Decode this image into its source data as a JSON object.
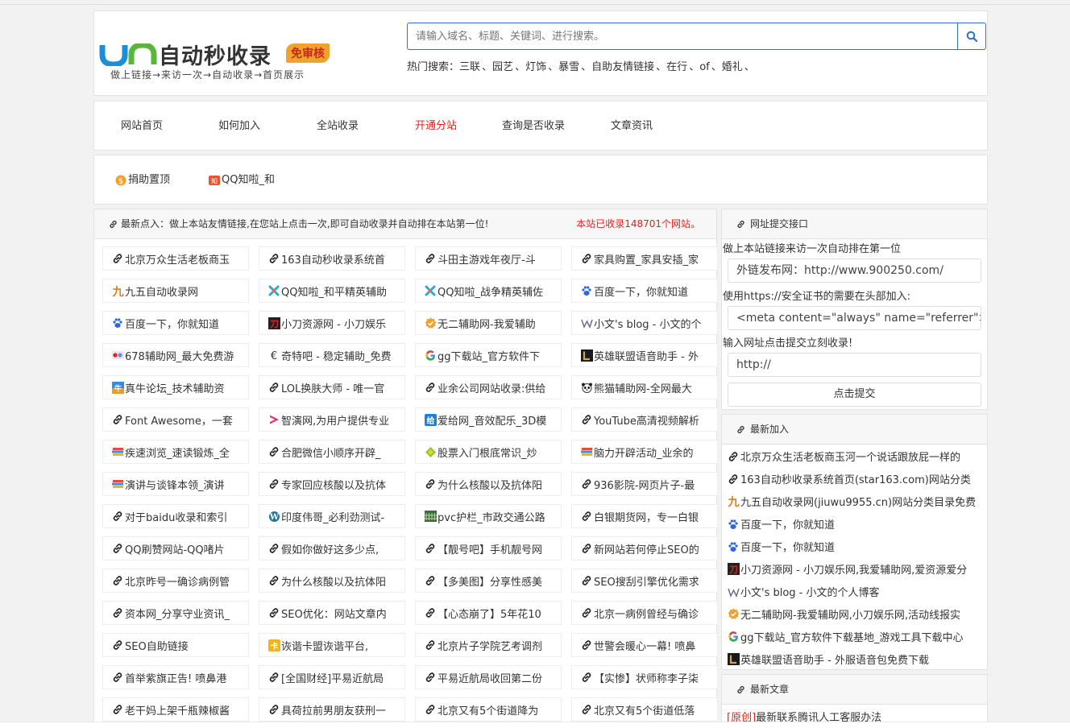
{
  "logo": {
    "text": "自动秒收录",
    "badge": "免审核",
    "subtitle": "做上链接→来访一次→自动收录→首页展示",
    "colors": {
      "blue": "#1a8fd8",
      "green": "#58b63b",
      "badge": "#f0a22c"
    }
  },
  "search": {
    "placeholder": "请输入域名、标题、关键词、进行搜索。",
    "icon": "search-icon",
    "hot_label": "热门搜索：",
    "hot_keywords": [
      "三联",
      "园艺",
      "灯饰",
      "暴雪",
      "自助友情链接",
      "在行",
      "of",
      "婚礼"
    ]
  },
  "nav": {
    "items": [
      "网站首页",
      "如何加入",
      "全站收录",
      "开通分站",
      "查询是否收录",
      "文章资讯"
    ],
    "active_color": "#e4211e"
  },
  "subnav": {
    "items": [
      {
        "label": "捐助置顶",
        "icon": "dollar-coin-icon"
      },
      {
        "label": "QQ知啦_和",
        "icon": "qq-zhila-icon"
      }
    ]
  },
  "main": {
    "note": "最新点入：做上本站友情链接,在您站上点击一次,即可自动收录并自动排在本站第一位!",
    "count": "本站已收录148701个网站。",
    "sites": [
      {
        "t": "北京万众生活老板商玉",
        "i": "link-icon"
      },
      {
        "t": "163自动秒收录系统首",
        "i": "link-icon"
      },
      {
        "t": "斗田主游戏年夜厅-斗",
        "i": "link-icon"
      },
      {
        "t": "家具购置_家具安插_家",
        "i": "link-icon"
      },
      {
        "t": "九五自动收录网",
        "i": "jiuwu-icon"
      },
      {
        "t": "QQ知啦_和平精英辅助",
        "i": "qq-zhila-icon"
      },
      {
        "t": "QQ知啦_战争精英辅佐",
        "i": "qq-zhila-icon"
      },
      {
        "t": "百度一下，你就知道",
        "i": "baidu-paw-icon"
      },
      {
        "t": "百度一下，你就知道",
        "i": "baidu-paw-icon"
      },
      {
        "t": "小刀资源网 - 小刀娱乐",
        "i": "xiaodao-icon"
      },
      {
        "t": "无二辅助网-我爱辅助",
        "i": "badge-check-icon"
      },
      {
        "t": "小文's blog - 小文的个",
        "i": "w-logo-icon"
      },
      {
        "t": "678辅助网_最大免费游",
        "i": "678-icon"
      },
      {
        "t": "奇特吧 - 稳定辅助_免费",
        "i": "euro-icon"
      },
      {
        "t": "gg下载站_官方软件下",
        "i": "google-g-icon"
      },
      {
        "t": "英雄联盟语音助手 - 外",
        "i": "lol-icon"
      },
      {
        "t": "真牛论坛_技术辅助资",
        "i": "zhenniu-icon"
      },
      {
        "t": "LOL换肤大师 - 唯一官",
        "i": "link-icon"
      },
      {
        "t": "业余公司网站收录:供给",
        "i": "link-icon"
      },
      {
        "t": "熊猫辅助网-全网最大",
        "i": "panda-icon"
      },
      {
        "t": "Font Awesome，一套",
        "i": "link-icon"
      },
      {
        "t": "智演网,为用户提供专业",
        "i": "play-icon"
      },
      {
        "t": "爱给网_音效配乐_3D模",
        "i": "aigei-icon"
      },
      {
        "t": "YouTube高清视频解析",
        "i": "link-icon"
      },
      {
        "t": "疾速浏览_速读锻炼_全",
        "i": "books-icon"
      },
      {
        "t": "合肥微信小顺序开辟_",
        "i": "link-icon"
      },
      {
        "t": "股票入门根底常识_炒",
        "i": "diamond-icon"
      },
      {
        "t": "脑力开辟活动_业余的",
        "i": "books-icon"
      },
      {
        "t": "演讲与谈锋本领_演讲",
        "i": "books-icon"
      },
      {
        "t": "专家回应核酸以及抗体",
        "i": "link-icon"
      },
      {
        "t": "为什么核酸以及抗体阳",
        "i": "link-icon"
      },
      {
        "t": "936影院-网页片子-最",
        "i": "link-icon"
      },
      {
        "t": "对于baidu收录和索引",
        "i": "link-icon"
      },
      {
        "t": "印度伟哥_必利劲测试-",
        "i": "wordpress-icon"
      },
      {
        "t": "pvc护栏_市政交通公路",
        "i": "fence-icon"
      },
      {
        "t": "白银期货网，专一白银",
        "i": "link-icon"
      },
      {
        "t": "QQ刷赞网站-QQ啫片",
        "i": "link-icon"
      },
      {
        "t": "假如你做好这多少点,",
        "i": "link-icon"
      },
      {
        "t": "【靓号吧】手机靓号网",
        "i": "link-icon"
      },
      {
        "t": "新网站若何停止SEO的",
        "i": "link-icon"
      },
      {
        "t": "北京昨号一确诊病例管",
        "i": "link-icon"
      },
      {
        "t": "为什么核酸以及抗体阳",
        "i": "link-icon"
      },
      {
        "t": "【多美图】分享性感美",
        "i": "link-icon"
      },
      {
        "t": "SEO搜刮引擎优化需求",
        "i": "link-icon"
      },
      {
        "t": "资本网_分享守业资讯_",
        "i": "link-icon"
      },
      {
        "t": "SEO优化：网站文章内",
        "i": "link-icon"
      },
      {
        "t": "【心态崩了】5年花10",
        "i": "link-icon"
      },
      {
        "t": "北京一病例曾经与确诊",
        "i": "link-icon"
      },
      {
        "t": "SEO自助链接",
        "i": "link-icon"
      },
      {
        "t": "诙谐卡盟诙谐平台,",
        "i": "huixie-icon"
      },
      {
        "t": "北京片子学院艺考调剂",
        "i": "link-icon"
      },
      {
        "t": "世警会暖心一幕! 喷鼻",
        "i": "link-icon"
      },
      {
        "t": "首举紫旗正告! 喷鼻港",
        "i": "link-icon"
      },
      {
        "t": "[全国财经]平易近航局",
        "i": "link-icon"
      },
      {
        "t": "平易近航局收回第二份",
        "i": "link-icon"
      },
      {
        "t": "【实惨】状师称李子柒",
        "i": "link-icon"
      },
      {
        "t": "老干妈上架千瓶辣椒酱",
        "i": "link-icon"
      },
      {
        "t": "具荷拉前男朋友获刑一",
        "i": "link-icon"
      },
      {
        "t": "北京又有5个街道降为",
        "i": "link-icon"
      },
      {
        "t": "北京又有5个街道低落",
        "i": "link-icon"
      }
    ]
  },
  "submit": {
    "title": "网址提交接口",
    "line1": "做上本站链接来访一次自动排在第一位",
    "box1": "外链发布网：http://www.900250.com/",
    "line2": "使用https://安全证书的需要在头部加入:",
    "box2": "<meta content=\"always\" name=\"referrer\">",
    "line3": "输入网址点击提交立刻收录!",
    "input_value": "http://",
    "button": "点击提交"
  },
  "latest": {
    "title": "最新加入",
    "items": [
      {
        "t": "北京万众生活老板商玉河一个说话跟放屁一样的",
        "i": "link-icon"
      },
      {
        "t": "163自动秒收录系统首页(star163.com)网站分类",
        "i": "link-icon"
      },
      {
        "t": "九五自动收录网(jiuwu9955.cn)网站分类目录免费",
        "i": "jiuwu-icon"
      },
      {
        "t": "百度一下，你就知道",
        "i": "baidu-paw-icon"
      },
      {
        "t": "百度一下，你就知道",
        "i": "baidu-paw-icon"
      },
      {
        "t": "小刀资源网 - 小刀娱乐网,我爱辅助网,爱资源爱分",
        "i": "xiaodao-icon"
      },
      {
        "t": "小文's blog - 小文的个人博客",
        "i": "w-logo-icon"
      },
      {
        "t": "无二辅助网-我爱辅助网,小刀娱乐网,活动线报实",
        "i": "badge-check-icon"
      },
      {
        "t": "gg下载站_官方软件下载基地_游戏工具下载中心",
        "i": "google-g-icon"
      },
      {
        "t": "英雄联盟语音助手 - 外服语音包免费下载",
        "i": "lol-icon"
      }
    ]
  },
  "articles": {
    "title": "最新文章",
    "items": [
      {
        "tag": "[原创]",
        "t": "最新联系腾讯人工客服办法"
      }
    ]
  }
}
